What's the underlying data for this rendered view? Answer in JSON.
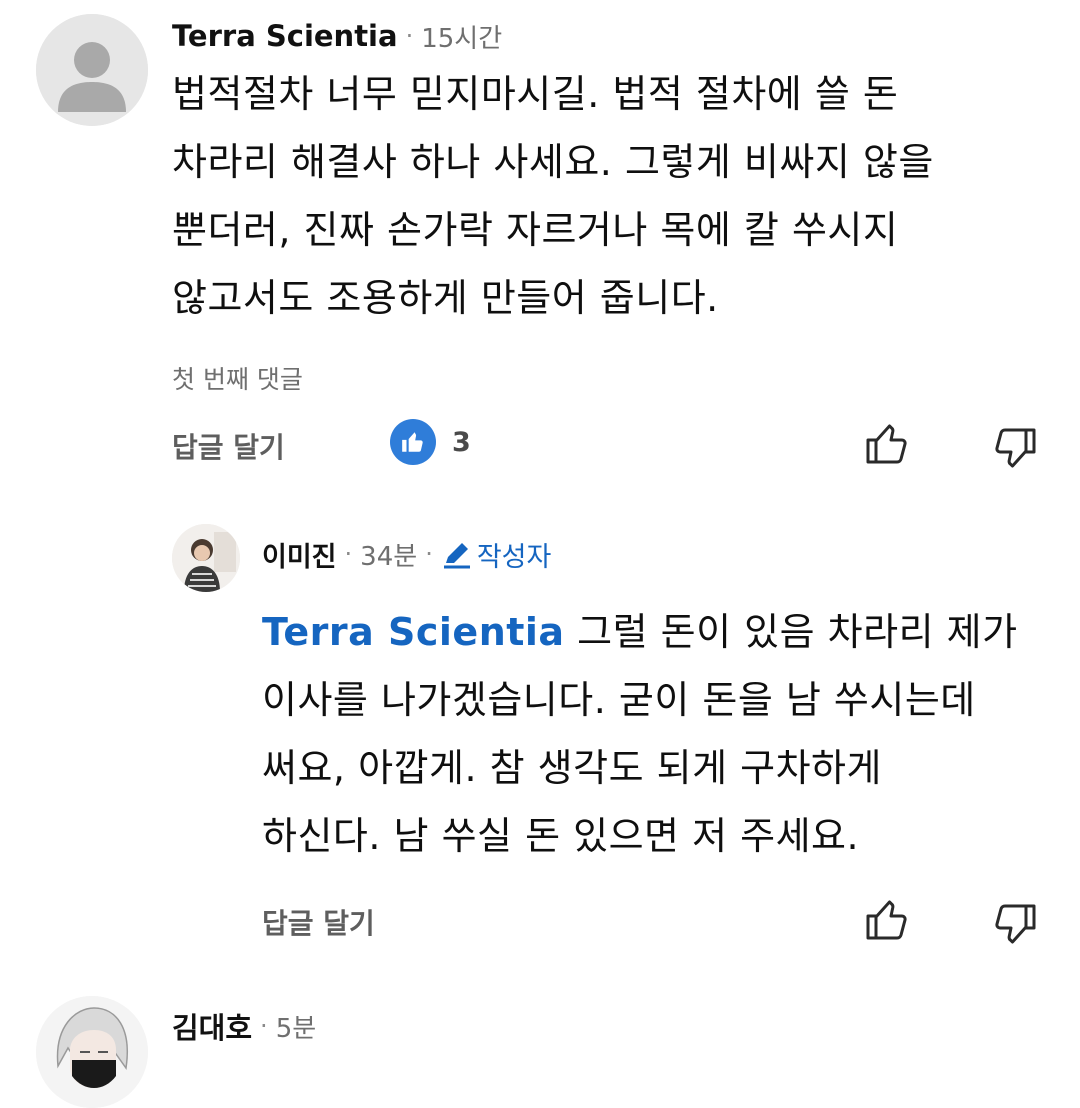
{
  "comment1": {
    "author": "Terra Scientia",
    "time": "15시간",
    "text": "법적절차 너무 믿지마시길. 법적 절차에 쓸 돈\n차라리 해결사 하나 사세요. 그렇게 비싸지 않을\n뿐더러, 진짜 손가락 자르거나 목에 칼 쑤시지\n않고서도 조용하게 만들어 줍니다.",
    "label": "첫 번째 댓글",
    "reply_label": "답글 달기",
    "like_count": "3"
  },
  "reply1": {
    "author": "이미진",
    "time": "34분",
    "author_badge": "작성자",
    "mention": "Terra Scientia",
    "text": " 그럴 돈이 있음 차라리 제가\n이사를 나가겠습니다. 굳이 돈을 남 쑤시는데\n써요, 아깝게. 참 생각도 되게 구차하게\n하신다. 남 쑤실 돈 있으면 저 주세요.",
    "reply_label": "답글 달기"
  },
  "comment2": {
    "author": "김대호",
    "time": "5분"
  },
  "separator": "·",
  "colors": {
    "accent": "#1565c0",
    "like_badge": "#2f7dd9",
    "muted": "#6f6f6f"
  },
  "icons": [
    "default-avatar-icon",
    "like-badge-icon",
    "thumbs-up-icon",
    "thumbs-down-icon",
    "pencil-icon"
  ]
}
